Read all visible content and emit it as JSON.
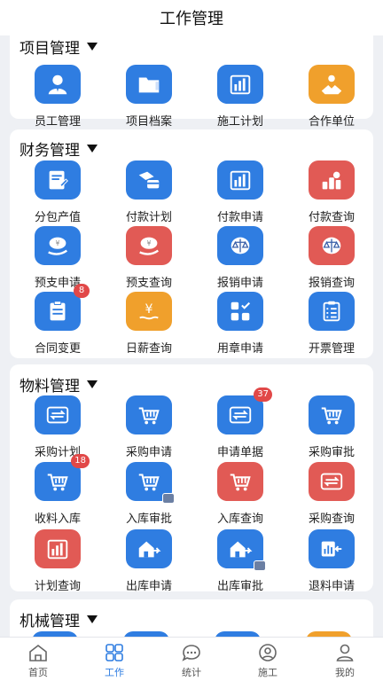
{
  "header": {
    "title": "工作管理"
  },
  "colors": {
    "blue": "#2f7de1",
    "orange": "#f0a02c",
    "red": "#e15a55",
    "badge": "#e14848",
    "tab_active": "#2f7de1"
  },
  "sections": [
    {
      "title": "项目管理",
      "items": [
        {
          "label": "员工管理",
          "icon": "user-icon",
          "color": "blue"
        },
        {
          "label": "项目档案",
          "icon": "folder-icon",
          "color": "blue"
        },
        {
          "label": "施工计划",
          "icon": "bar-chart-icon",
          "color": "blue"
        },
        {
          "label": "合作单位",
          "icon": "handshake-icon",
          "color": "orange"
        }
      ]
    },
    {
      "title": "财务管理",
      "items": [
        {
          "label": "分包产值",
          "icon": "document-edit-icon",
          "color": "blue"
        },
        {
          "label": "付款计划",
          "icon": "card-payment-icon",
          "color": "blue"
        },
        {
          "label": "付款申请",
          "icon": "bar-chart-icon",
          "color": "blue"
        },
        {
          "label": "付款查询",
          "icon": "coins-stack-icon",
          "color": "red"
        },
        {
          "label": "预支申请",
          "icon": "money-hand-icon",
          "color": "blue"
        },
        {
          "label": "预支查询",
          "icon": "money-hand-icon",
          "color": "red"
        },
        {
          "label": "报销申请",
          "icon": "balance-scale-icon",
          "color": "blue"
        },
        {
          "label": "报销查询",
          "icon": "balance-scale-icon",
          "color": "red"
        },
        {
          "label": "合同变更",
          "icon": "clipboard-icon",
          "color": "blue",
          "badge": "8"
        },
        {
          "label": "日薪查询",
          "icon": "yen-icon",
          "color": "orange"
        },
        {
          "label": "用章申请",
          "icon": "grid-check-icon",
          "color": "blue"
        },
        {
          "label": "开票管理",
          "icon": "checklist-icon",
          "color": "blue"
        }
      ]
    },
    {
      "title": "物料管理",
      "items": [
        {
          "label": "采购计划",
          "icon": "transfer-icon",
          "color": "blue"
        },
        {
          "label": "采购申请",
          "icon": "cart-icon",
          "color": "blue"
        },
        {
          "label": "申请单据",
          "icon": "transfer-icon",
          "color": "blue",
          "badge": "37"
        },
        {
          "label": "采购审批",
          "icon": "cart-icon",
          "color": "blue"
        },
        {
          "label": "收料入库",
          "icon": "cart-icon",
          "color": "blue",
          "badge": "18"
        },
        {
          "label": "入库审批",
          "icon": "cart-icon",
          "color": "blue",
          "corner": true
        },
        {
          "label": "入库查询",
          "icon": "cart-icon",
          "color": "red"
        },
        {
          "label": "采购查询",
          "icon": "transfer-icon",
          "color": "red"
        },
        {
          "label": "计划查询",
          "icon": "bar-chart-icon",
          "color": "red"
        },
        {
          "label": "出库申请",
          "icon": "house-arrow-icon",
          "color": "blue"
        },
        {
          "label": "出库审批",
          "icon": "house-arrow-icon",
          "color": "blue",
          "corner": true
        },
        {
          "label": "退料申请",
          "icon": "chart-return-icon",
          "color": "blue"
        }
      ]
    },
    {
      "title": "机械管理",
      "items": []
    }
  ],
  "tabs": [
    {
      "label": "首页",
      "icon": "home-icon",
      "active": false
    },
    {
      "label": "工作",
      "icon": "grid-icon",
      "active": true
    },
    {
      "label": "统计",
      "icon": "chat-icon",
      "active": false
    },
    {
      "label": "施工",
      "icon": "worker-icon",
      "active": false
    },
    {
      "label": "我的",
      "icon": "profile-icon",
      "active": false
    }
  ]
}
